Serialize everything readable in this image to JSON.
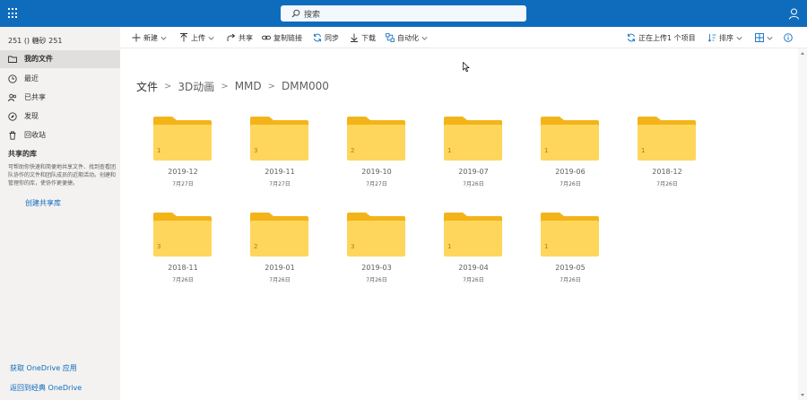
{
  "header": {
    "search_placeholder": "搜索"
  },
  "sidebar": {
    "account": "251 () 糖砂 251",
    "items": [
      {
        "label": "我的文件",
        "icon": "folder-icon",
        "selected": true
      },
      {
        "label": "最近",
        "icon": "clock-icon"
      },
      {
        "label": "已共享",
        "icon": "people-icon"
      },
      {
        "label": "发现",
        "icon": "compass-icon"
      },
      {
        "label": "回收站",
        "icon": "recycle-bin-icon"
      }
    ],
    "shared_libraries_title": "共享的库",
    "shared_libraries_desc": "可帮助你快速和简便地共享文件、找到查看团队协作的文件和团队成员的近期活动。创建和管理你的库，使协作更便捷。",
    "create_library_link": "创建共享库",
    "get_app_link": "获取 OneDrive 应用",
    "classic_link": "返回到经典 OneDrive"
  },
  "toolbar": {
    "new_label": "新建",
    "upload_label": "上传",
    "share_label": "共享",
    "copy_link_label": "复制链接",
    "sync_label": "同步",
    "download_label": "下载",
    "automate_label": "自动化",
    "uploading_status": "正在上传1 个项目",
    "sort_label": "排序"
  },
  "breadcrumb": [
    "文件",
    "3D动画",
    "MMD",
    "DMM000"
  ],
  "folders": [
    {
      "name": "2019-12",
      "date": "7月27日",
      "count": "1"
    },
    {
      "name": "2019-11",
      "date": "7月27日",
      "count": "3"
    },
    {
      "name": "2019-10",
      "date": "7月27日",
      "count": "2"
    },
    {
      "name": "2019-07",
      "date": "7月26日",
      "count": "1"
    },
    {
      "name": "2019-06",
      "date": "7月26日",
      "count": "1"
    },
    {
      "name": "2018-12",
      "date": "7月26日",
      "count": "1"
    },
    {
      "name": "2018-11",
      "date": "7月26日",
      "count": "3"
    },
    {
      "name": "2019-01",
      "date": "7月26日",
      "count": "2"
    },
    {
      "name": "2019-03",
      "date": "7月26日",
      "count": "3"
    },
    {
      "name": "2019-04",
      "date": "7月26日",
      "count": "1"
    },
    {
      "name": "2019-05",
      "date": "7月26日",
      "count": "1"
    }
  ],
  "colors": {
    "brand": "#0f6cbd",
    "folder_back": "#f3b41a",
    "folder_front": "#ffd65c"
  }
}
